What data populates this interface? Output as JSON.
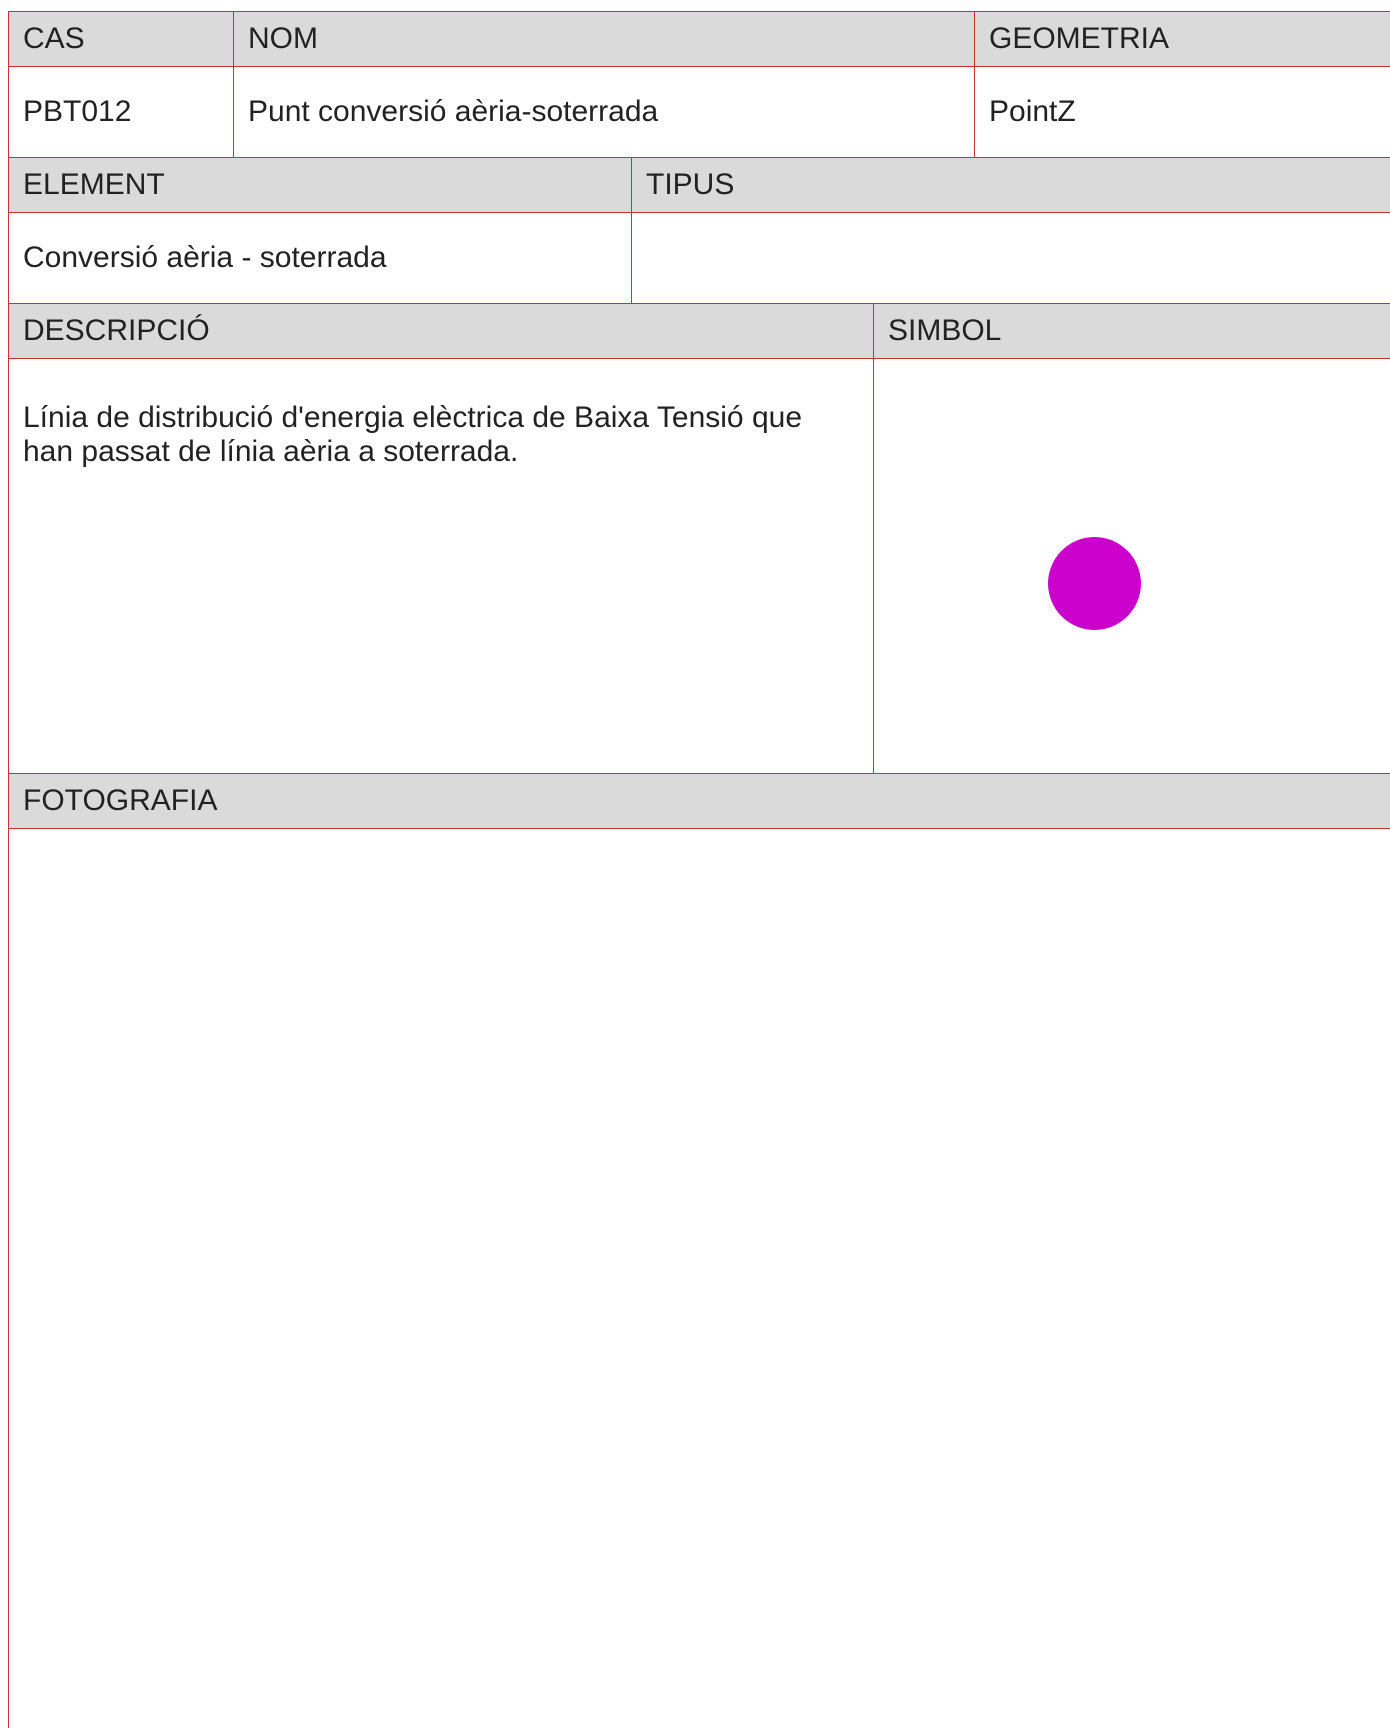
{
  "header_row_1": {
    "cas_label": "CAS",
    "nom_label": "NOM",
    "geometria_label": "GEOMETRIA"
  },
  "values_row_1": {
    "cas": "PBT012",
    "nom": "Punt conversió aèria-soterrada",
    "geometria": "PointZ"
  },
  "header_row_2": {
    "element_label": "ELEMENT",
    "tipus_label": "TIPUS"
  },
  "values_row_2": {
    "element": "Conversió aèria - soterrada",
    "tipus": ""
  },
  "header_row_3": {
    "descripcio_label": "DESCRIPCIÓ",
    "simbol_label": "SIMBOL"
  },
  "values_row_3": {
    "descripcio": "Línia de distribució d'energia elèctrica de Baixa Tensió que han passat de línia aèria a soterrada.",
    "simbol_icon": "filled-circle-icon",
    "simbol_color": "#cc00cc"
  },
  "header_row_4": {
    "fotografia_label": "FOTOGRAFIA"
  },
  "colors": {
    "border": "#c8323c",
    "header_background": "#dadada"
  }
}
